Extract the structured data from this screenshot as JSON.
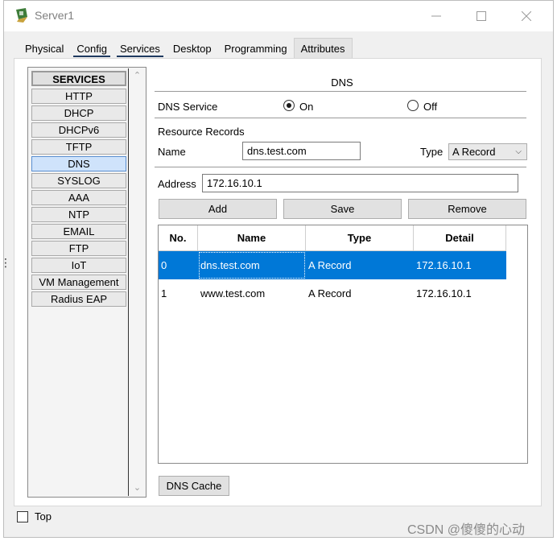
{
  "window": {
    "title": "Server1"
  },
  "tabs": [
    {
      "label": "Physical"
    },
    {
      "label": "Config"
    },
    {
      "label": "Services"
    },
    {
      "label": "Desktop"
    },
    {
      "label": "Programming"
    },
    {
      "label": "Attributes"
    }
  ],
  "sidebar": {
    "header": "SERVICES",
    "items": [
      "HTTP",
      "DHCP",
      "DHCPv6",
      "TFTP",
      "DNS",
      "SYSLOG",
      "AAA",
      "NTP",
      "EMAIL",
      "FTP",
      "IoT",
      "VM Management",
      "Radius EAP"
    ],
    "selected": "DNS"
  },
  "dns": {
    "title": "DNS",
    "service_label": "DNS Service",
    "on_label": "On",
    "off_label": "Off",
    "service_state": "On",
    "resource_records_label": "Resource Records",
    "name_label": "Name",
    "name_value": "dns.test.com",
    "type_label": "Type",
    "type_value": "A Record",
    "address_label": "Address",
    "address_value": "172.16.10.1",
    "add_label": "Add",
    "save_label": "Save",
    "remove_label": "Remove",
    "cache_label": "DNS Cache"
  },
  "table": {
    "headers": [
      "No.",
      "Name",
      "Type",
      "Detail"
    ],
    "rows": [
      [
        "0",
        "dns.test.com",
        "A Record",
        "172.16.10.1"
      ],
      [
        "1",
        "www.test.com",
        "A Record",
        "172.16.10.1"
      ]
    ],
    "selected_row": 0
  },
  "footer": {
    "top_label": "Top"
  },
  "watermark": "CSDN @傻傻的心动",
  "colors": {
    "selection": "#0078d7",
    "sidebar_selected": "#cfe3fb"
  }
}
